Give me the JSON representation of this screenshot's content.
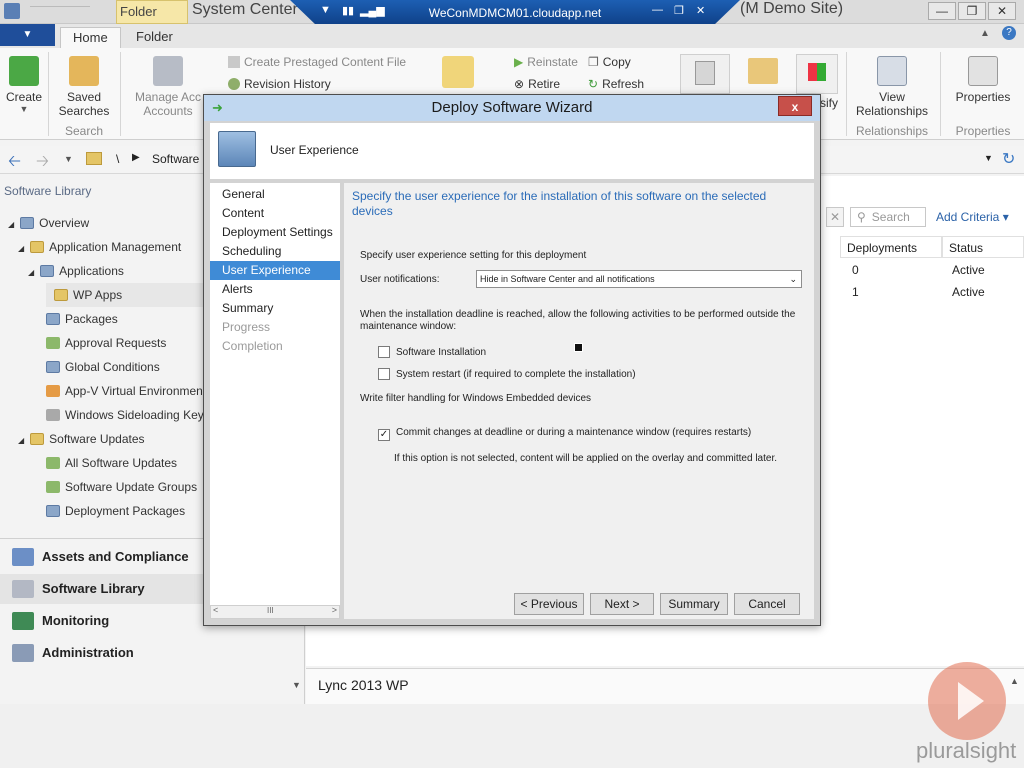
{
  "window": {
    "contextual_tab": "Folder Tools",
    "title": "System Center",
    "rdp_host": "WeConMDMCM01.cloudapp.net",
    "title_suffix": "(M Demo Site)"
  },
  "tabs": [
    {
      "label": "Home"
    },
    {
      "label": "Folder"
    }
  ],
  "ribbon": {
    "create": "Create",
    "saved": "Saved",
    "searches": "Searches",
    "search_group": "Search",
    "manage1": "Manage Acc",
    "manage2": "Accounts",
    "prestaged": "Create Prestaged Content File",
    "revision": "Revision History",
    "reinstate": "Reinstate",
    "retire": "Retire",
    "copy": "Copy",
    "refresh": "Refresh",
    "view1": "View",
    "view2": "Relationships",
    "rel_group": "Relationships",
    "properties": "Properties",
    "prop_group": "Properties"
  },
  "nav": {
    "path_sep": "\\",
    "path_item": "Software"
  },
  "left": {
    "title": "Software Library",
    "tree": [
      {
        "label": "Overview"
      },
      {
        "label": "Application Management"
      },
      {
        "label": "Applications"
      },
      {
        "label": "WP Apps"
      },
      {
        "label": "Packages"
      },
      {
        "label": "Approval Requests"
      },
      {
        "label": "Global Conditions"
      },
      {
        "label": "App-V Virtual Environmen"
      },
      {
        "label": "Windows Sideloading Keys"
      },
      {
        "label": "Software Updates"
      },
      {
        "label": "All Software Updates"
      },
      {
        "label": "Software Update Groups"
      },
      {
        "label": "Deployment Packages"
      }
    ],
    "workspaces": [
      {
        "label": "Assets and Compliance"
      },
      {
        "label": "Software Library"
      },
      {
        "label": "Monitoring"
      },
      {
        "label": "Administration"
      }
    ]
  },
  "list": {
    "search_placeholder": "Search",
    "add_criteria": "Add Criteria",
    "columns": [
      "Deployments",
      "Status"
    ],
    "rows": [
      {
        "deployments": "0",
        "status": "Active"
      },
      {
        "deployments": "1",
        "status": "Active"
      }
    ],
    "ribbon_partial": "sify"
  },
  "bottom": {
    "selected": "Lync 2013 WP"
  },
  "dialog": {
    "title": "Deploy Software Wizard",
    "close": "x",
    "page": "User Experience",
    "steps": [
      {
        "label": "General"
      },
      {
        "label": "Content"
      },
      {
        "label": "Deployment Settings"
      },
      {
        "label": "Scheduling"
      },
      {
        "label": "User Experience"
      },
      {
        "label": "Alerts"
      },
      {
        "label": "Summary"
      },
      {
        "label": "Progress"
      },
      {
        "label": "Completion"
      }
    ],
    "heading": "Specify the user experience for the installation of this software on the selected devices",
    "setting_label": "Specify user experience setting for this deployment",
    "notif_label": "User notifications:",
    "notif_value": "Hide in Software Center and all notifications",
    "deadline_text": "When the installation deadline is reached, allow the following activities to be performed outside the maintenance window:",
    "cb_install": "Software Installation",
    "cb_install_checked": false,
    "cb_restart": "System restart  (if required to complete the installation)",
    "cb_restart_checked": false,
    "write_filter": "Write filter handling for Windows Embedded devices",
    "cb_commit": "Commit changes at deadline or during a maintenance window (requires restarts)",
    "cb_commit_checked": true,
    "commit_note": "If this option is not selected, content will be applied on the overlay and committed later.",
    "buttons": {
      "previous": "< Previous",
      "next": "Next >",
      "summary": "Summary",
      "cancel": "Cancel"
    },
    "scroll_mark": "III"
  },
  "watermark": "pluralsight"
}
